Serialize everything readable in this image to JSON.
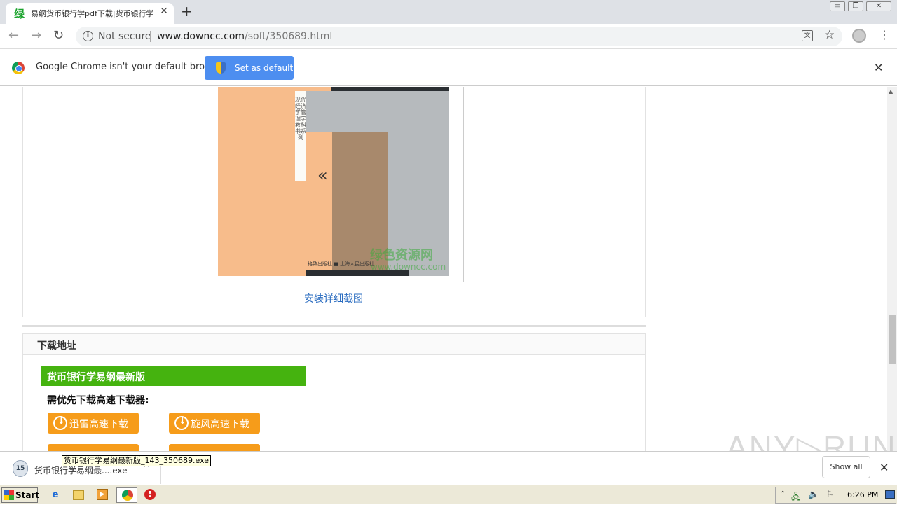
{
  "browser": {
    "tab_title": "易纲货币银行学pdf下载|货币银行学",
    "tab_favicon": "绿",
    "new_tab_symbol": "+",
    "close_symbol": "✕",
    "window_controls": [
      "▭",
      "❐",
      "✕"
    ],
    "security_label": "Not secure",
    "url_host": "www.downcc.com",
    "url_path": "/soft/350689.html"
  },
  "infobar": {
    "message": "Google Chrome isn't your default browser",
    "button_label": "Set as default"
  },
  "page": {
    "cover_vertical_text": "现代经济学管理学教科书系列",
    "cover_arrows": "«",
    "cover_publisher": "格致出版社 ■ 上海人民出版社",
    "watermark_name": "绿色资源网",
    "watermark_url": "www.downcc.com",
    "screenshot_caption": "安装详细截图",
    "download_section_title": "下载地址",
    "version_title": "货币银行学易纲最新版",
    "prereq_text": "需优先下载高速下载器:",
    "download_buttons": [
      "迅雷高速下载",
      "旋风高速下载"
    ]
  },
  "download_shelf": {
    "item_name": "货币银行学易纲最....exe",
    "tooltip": "货币银行学易纲最新版_143_350689.exe",
    "show_all": "Show all"
  },
  "watermark": "ANY▷RUN",
  "taskbar": {
    "start_label": "Start",
    "clock": "6:26 PM"
  },
  "colors": {
    "accent_button": "#4d8ef0",
    "green_header": "#45b30f",
    "download_button": "#f69c1a",
    "link": "#2a6cc0"
  }
}
